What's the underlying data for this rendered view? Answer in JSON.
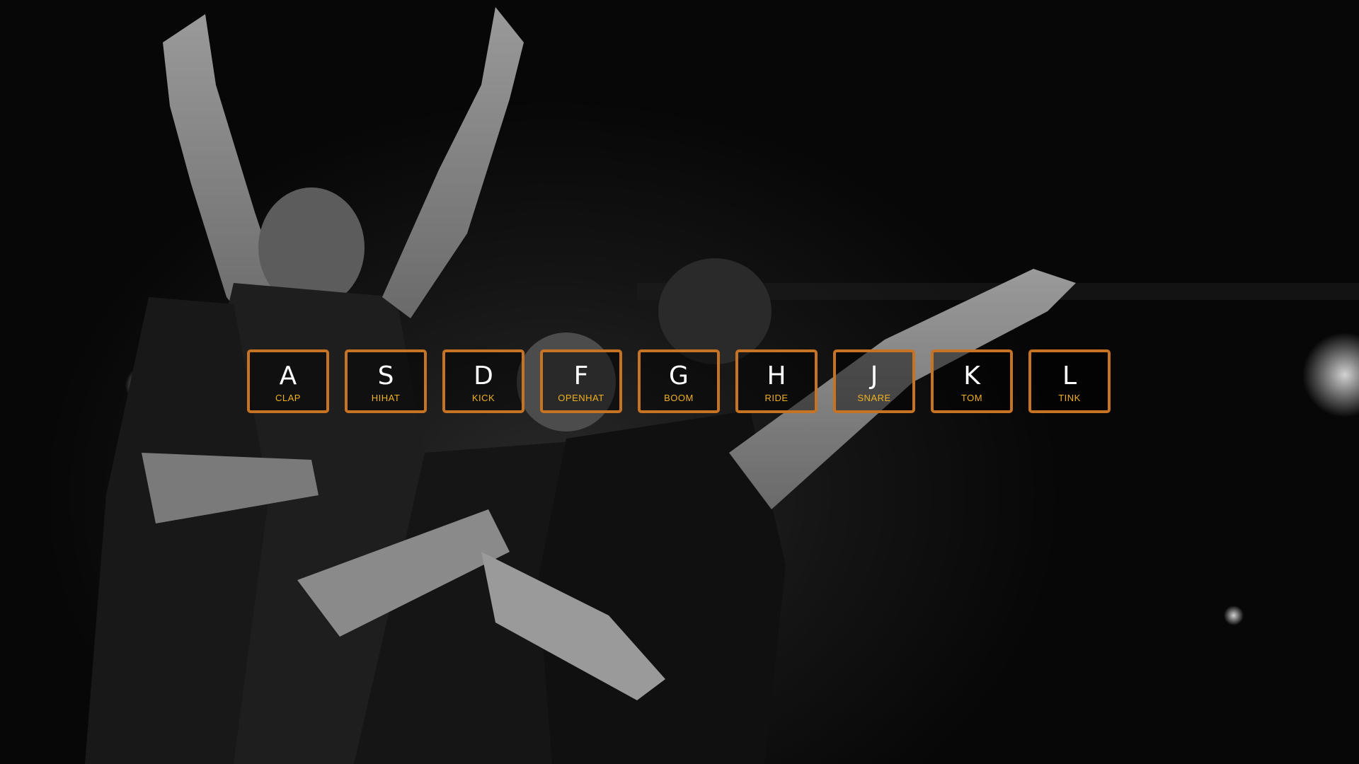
{
  "drum_kit": {
    "keys": [
      {
        "letter": "A",
        "sound": "CLAP"
      },
      {
        "letter": "S",
        "sound": "HIHAT"
      },
      {
        "letter": "D",
        "sound": "KICK"
      },
      {
        "letter": "F",
        "sound": "OPENHAT"
      },
      {
        "letter": "G",
        "sound": "BOOM"
      },
      {
        "letter": "H",
        "sound": "RIDE"
      },
      {
        "letter": "J",
        "sound": "SNARE"
      },
      {
        "letter": "K",
        "sound": "TOM"
      },
      {
        "letter": "L",
        "sound": "TINK"
      }
    ]
  },
  "theme": {
    "border_color": "#c67323",
    "sound_label_color": "#f0b020",
    "letter_color": "#ffffff"
  },
  "background": {
    "description_icon": "concert-band-photo"
  }
}
